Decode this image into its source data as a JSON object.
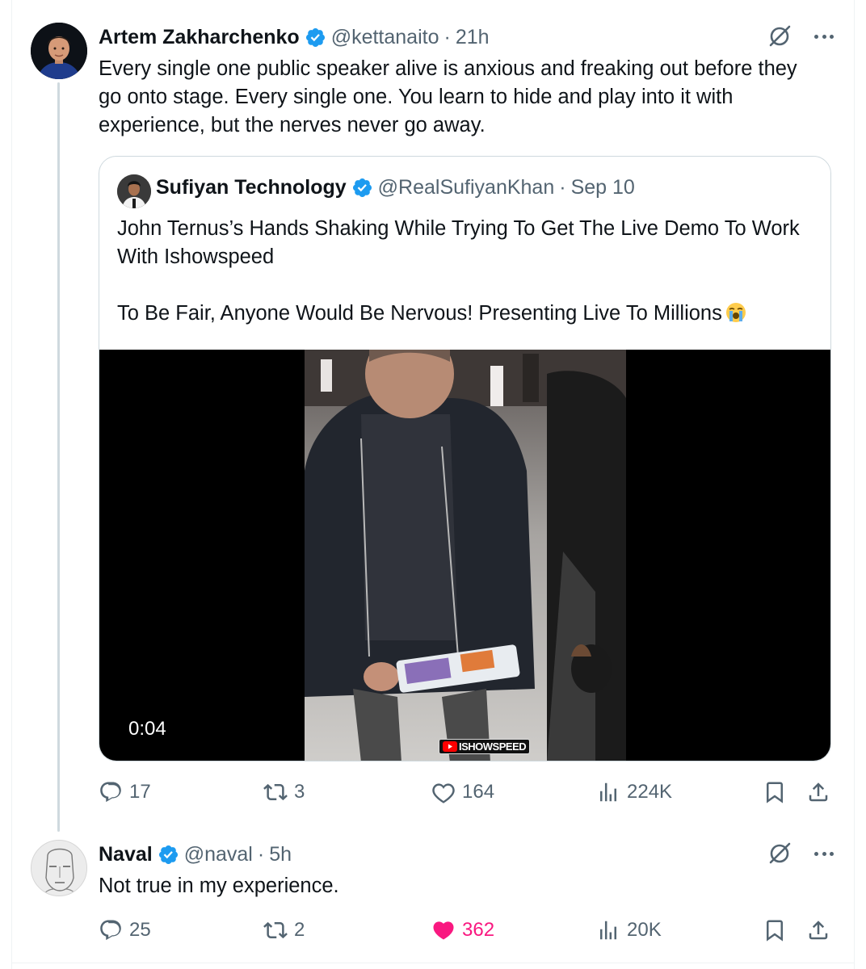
{
  "tweet": {
    "author_name": "Artem Zakharchenko",
    "handle": "@kettanaito",
    "separator": "·",
    "time": "21h",
    "text": "Every single one public speaker alive is anxious and freaking out before they go onto stage. Every single one. You learn to hide and play into it with experience, but the nerves never go away.",
    "quote": {
      "author_name": "Sufiyan Technology",
      "handle": "@RealSufiyanKhan",
      "separator": "·",
      "date": "Sep 10",
      "text_line1": "John Ternus’s Hands Shaking While Trying To Get The Live Demo To Work With Ishowspeed",
      "text_line2": "To Be Fair, Anyone Would Be Nervous! Presenting Live To Millions",
      "emoji": "loudly-crying-face",
      "video": {
        "duration": "0:04",
        "watermark": "ISHOWSPEED"
      }
    },
    "stats": {
      "replies": "17",
      "reposts": "3",
      "likes": "164",
      "views": "224K"
    }
  },
  "reply": {
    "author_name": "Naval",
    "handle": "@naval",
    "separator": "·",
    "time": "5h",
    "text": "Not true in my experience.",
    "stats": {
      "replies": "25",
      "reposts": "2",
      "likes": "362",
      "views": "20K",
      "liked": true
    }
  },
  "colors": {
    "text_primary": "#0f1419",
    "text_secondary": "#536471",
    "verified_blue": "#1d9bf0",
    "like_pink": "#f91880",
    "border": "#cfd9de"
  },
  "icons": [
    "verified-badge-icon",
    "grok-icon",
    "more-icon",
    "reply-icon",
    "repost-icon",
    "like-icon",
    "views-icon",
    "bookmark-icon",
    "share-icon"
  ]
}
